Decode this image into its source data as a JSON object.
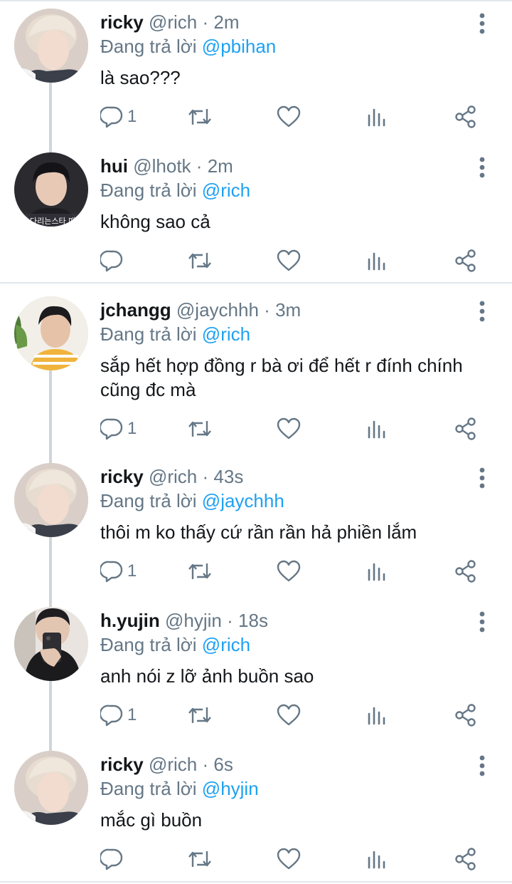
{
  "tweets": [
    {
      "name": "ricky",
      "handle": "@rich",
      "dot": "·",
      "time": "2m",
      "reply_prefix": "Đang trả lời",
      "reply_to": "@pbihan",
      "text": "là sao???",
      "reply_count": "1"
    },
    {
      "name": "hui",
      "handle": "@lhotk",
      "dot": "·",
      "time": "2m",
      "reply_prefix": "Đang trả lời",
      "reply_to": "@rich",
      "text": "không sao cả",
      "reply_count": ""
    },
    {
      "name": "jchangg",
      "handle": "@jaychhh",
      "dot": "·",
      "time": "3m",
      "reply_prefix": "Đang trả lời",
      "reply_to": "@rich",
      "text": "sắp hết hợp đồng r bà ơi để hết r đính chính cũng đc mà",
      "reply_count": "1"
    },
    {
      "name": "ricky",
      "handle": "@rich",
      "dot": "·",
      "time": "43s",
      "reply_prefix": "Đang trả lời",
      "reply_to": "@jaychhh",
      "text": "thôi m ko thấy cứ rần rần hả phiền lắm",
      "reply_count": "1"
    },
    {
      "name": "h.yujin",
      "handle": "@hyjin",
      "dot": "·",
      "time": "18s",
      "reply_prefix": "Đang trả lời",
      "reply_to": "@rich",
      "text": "anh nói z lỡ ảnh buồn sao",
      "reply_count": "1"
    },
    {
      "name": "ricky",
      "handle": "@rich",
      "dot": "·",
      "time": "6s",
      "reply_prefix": "Đang trả lời",
      "reply_to": "@hyjin",
      "text": "mắc gì buồn",
      "reply_count": ""
    }
  ],
  "avatar_text": "다리는스타 매",
  "colors": {
    "link": "#1da1f2",
    "secondary": "#657786",
    "primary_text": "#14171a",
    "divider": "#e1e8ed",
    "thread_line": "#cfd5da"
  },
  "icons": [
    "reply-icon",
    "retweet-icon",
    "like-icon",
    "analytics-icon",
    "share-icon",
    "more-icon"
  ]
}
